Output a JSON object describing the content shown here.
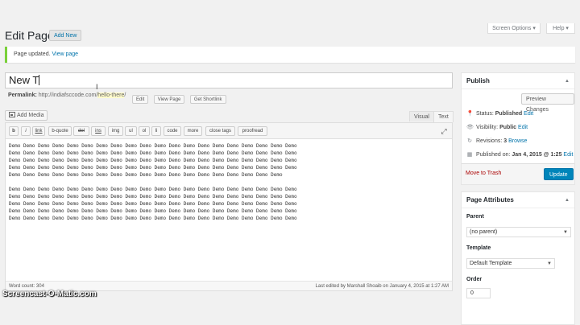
{
  "header": {
    "title": "Edit Page",
    "add_new": "Add New",
    "screen_options": "Screen Options ▾",
    "help": "Help ▾"
  },
  "notice": {
    "text": "Page updated.",
    "link": "View page"
  },
  "title_field": {
    "value": "New T"
  },
  "permalink": {
    "label": "Permalink:",
    "base": "http://indiafsccode.com/",
    "slug": "hello-there",
    "end": "/",
    "edit": "Edit",
    "view_page": "View Page",
    "get_shortlink": "Get Shortlink"
  },
  "editor": {
    "add_media": "Add Media",
    "tab_visual": "Visual",
    "tab_text": "Text",
    "fullscreen_icon": "fullscreen-icon",
    "quicktags": [
      "b",
      "i",
      "link",
      "b-quote",
      "del",
      "ins",
      "img",
      "ul",
      "ol",
      "li",
      "code",
      "more",
      "close tags",
      "proofread"
    ],
    "paragraphs": [
      "Demo Demo Demo Demo Demo Demo Demo Demo Demo Demo Demo Demo Demo Demo Demo Demo Demo Demo Demo Demo Demo Demo Demo Demo Demo Demo Demo Demo Demo Demo Demo Demo Demo Demo Demo Demo Demo Demo Demo Demo Demo Demo Demo Demo Demo Demo Demo Demo Demo Demo Demo Demo Demo Demo Demo Demo Demo Demo Demo Demo Demo Demo Demo Demo Demo Demo Demo Demo Demo Demo Demo Demo Demo Demo Demo Demo Demo Demo Demo Demo Demo Demo Demo Demo Demo Demo Demo Demo Demo Demo Demo Demo Demo Demo Demo Demo Demo Demo Demo",
      "Demo Demo Demo Demo Demo Demo Demo Demo Demo Demo Demo Demo Demo Demo Demo Demo Demo Demo Demo Demo Demo Demo Demo Demo Demo Demo Demo Demo Demo Demo Demo Demo Demo Demo Demo Demo Demo Demo Demo Demo Demo Demo Demo Demo Demo Demo Demo Demo Demo Demo Demo Demo Demo Demo Demo Demo Demo Demo Demo Demo Demo Demo Demo Demo Demo Demo Demo Demo Demo Demo Demo Demo Demo Demo Demo Demo Demo Demo Demo Demo Demo Demo Demo Demo Demo Demo Demo Demo Demo Demo Demo Demo Demo Demo Demo Demo Demo Demo Demo Demo"
    ],
    "status": {
      "word_count": "Word count: 304",
      "last_edited": "Last edited by Marshall Shoaib on January 4, 2015 at 1:27 AM"
    }
  },
  "publish": {
    "title": "Publish",
    "preview": "Preview Changes",
    "status_label": "Status:",
    "status_value": "Published",
    "visibility_label": "Visibility:",
    "visibility_value": "Public",
    "revisions_label": "Revisions:",
    "revisions_value": "3",
    "browse": "Browse",
    "published_on_label": "Published on:",
    "published_on_value": "Jan 4, 2015 @ 1:25",
    "edit": "Edit",
    "trash": "Move to Trash",
    "update": "Update"
  },
  "page_attributes": {
    "title": "Page Attributes",
    "parent_label": "Parent",
    "parent_value": "(no parent)",
    "template_label": "Template",
    "template_value": "Default Template",
    "order_label": "Order",
    "order_value": "0"
  },
  "watermark": "Screencast-O-Matic.com",
  "colors": {
    "background": "#f1f1f1",
    "link": "#0073aa",
    "primary_button": "#0085ba",
    "notice_border": "#7ad03a",
    "trash": "#a00"
  }
}
